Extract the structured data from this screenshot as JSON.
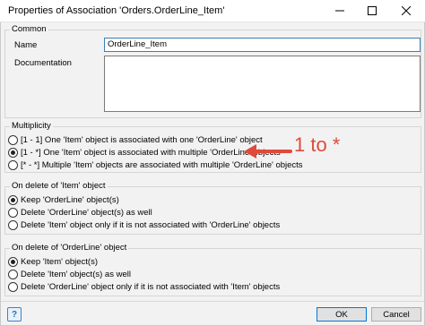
{
  "window": {
    "title": "Properties of Association 'Orders.OrderLine_Item'"
  },
  "common": {
    "group_label": "Common",
    "name_label": "Name",
    "name_value": "OrderLine_Item",
    "documentation_label": "Documentation",
    "documentation_value": ""
  },
  "multiplicity": {
    "group_label": "Multiplicity",
    "options": [
      {
        "label": "[1 - 1] One 'Item' object is associated with one 'OrderLine' object",
        "selected": false
      },
      {
        "label": "[1 - *] One 'Item' object is associated with multiple 'OrderLine' objects",
        "selected": true
      },
      {
        "label": "[* - *] Multiple 'Item' objects are associated with multiple 'OrderLine' objects",
        "selected": false
      }
    ]
  },
  "on_delete_item": {
    "group_label": "On delete of 'Item' object",
    "options": [
      {
        "label": "Keep 'OrderLine' object(s)",
        "selected": true
      },
      {
        "label": "Delete 'OrderLine' object(s) as well",
        "selected": false
      },
      {
        "label": "Delete 'Item' object only if it is not associated with 'OrderLine' objects",
        "selected": false
      }
    ]
  },
  "on_delete_orderline": {
    "group_label": "On delete of 'OrderLine' object",
    "options": [
      {
        "label": "Keep 'Item' object(s)",
        "selected": true
      },
      {
        "label": "Delete 'Item' object(s) as well",
        "selected": false
      },
      {
        "label": "Delete 'OrderLine' object only if it is not associated with 'Item' objects",
        "selected": false
      }
    ]
  },
  "annotation": {
    "text": "1 to *",
    "color": "#e04a3a"
  },
  "footer": {
    "help_label": "?",
    "ok_label": "OK",
    "cancel_label": "Cancel"
  },
  "icons": {
    "minimize": "minimize-icon",
    "maximize": "maximize-icon",
    "close": "close-icon",
    "help": "help-icon",
    "arrow": "red-arrow-icon"
  }
}
